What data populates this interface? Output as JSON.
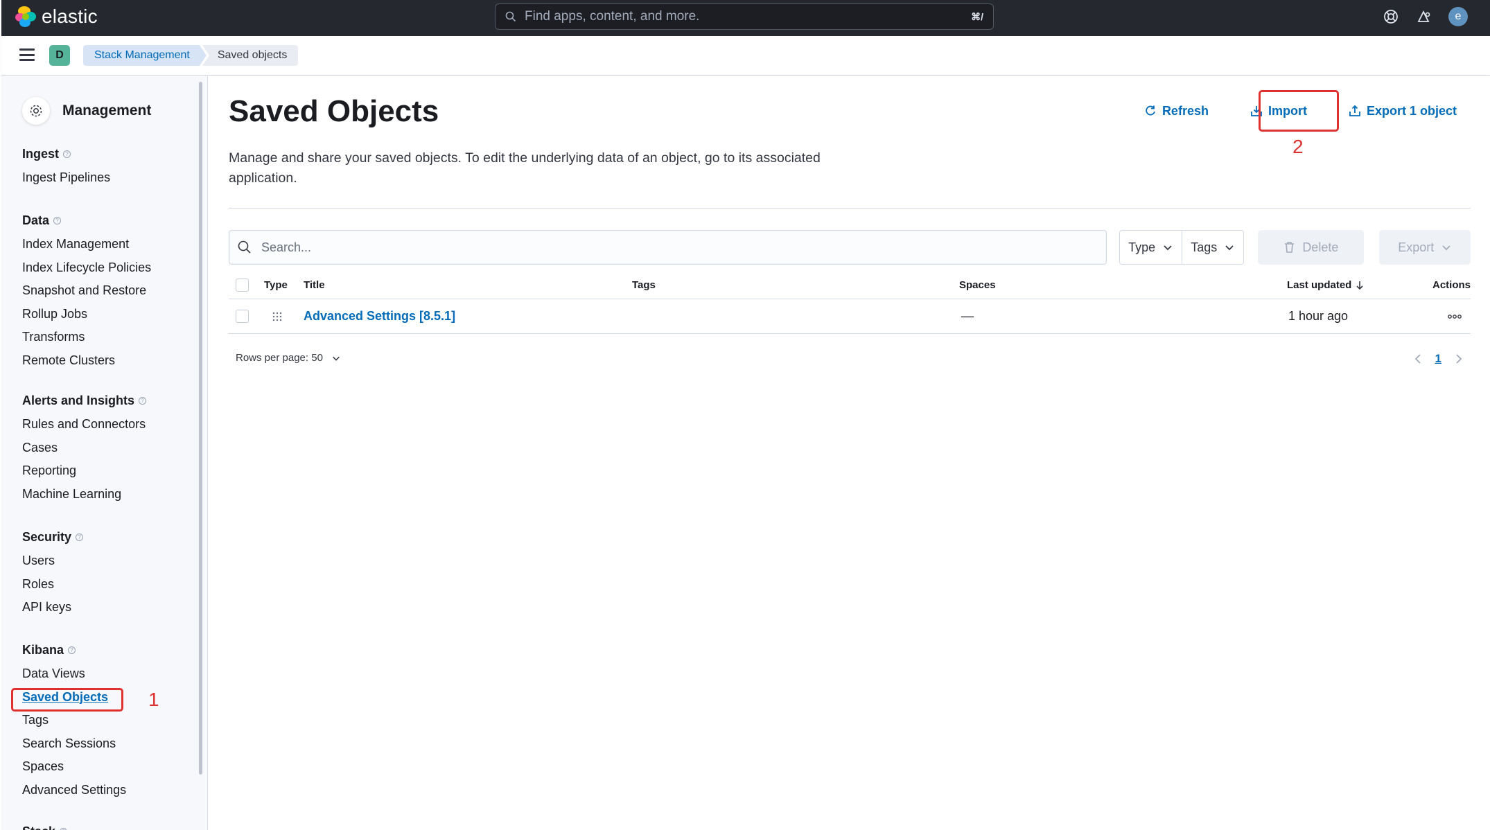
{
  "header": {
    "logo_text": "elastic",
    "search_placeholder": "Find apps, content, and more.",
    "search_shortcut": "⌘/",
    "user_initial": "e"
  },
  "breadcrumb": {
    "space_initial": "D",
    "items": [
      "Stack Management",
      "Saved objects"
    ]
  },
  "sidebar": {
    "title": "Management",
    "groups": [
      {
        "title": "Ingest",
        "items": [
          "Ingest Pipelines"
        ]
      },
      {
        "title": "Data",
        "items": [
          "Index Management",
          "Index Lifecycle Policies",
          "Snapshot and Restore",
          "Rollup Jobs",
          "Transforms",
          "Remote Clusters"
        ]
      },
      {
        "title": "Alerts and Insights",
        "items": [
          "Rules and Connectors",
          "Cases",
          "Reporting",
          "Machine Learning"
        ]
      },
      {
        "title": "Security",
        "items": [
          "Users",
          "Roles",
          "API keys"
        ]
      },
      {
        "title": "Kibana",
        "items": [
          "Data Views",
          "Saved Objects",
          "Tags",
          "Search Sessions",
          "Spaces",
          "Advanced Settings"
        ]
      },
      {
        "title": "Stack",
        "items": []
      }
    ],
    "active_item": "Saved Objects"
  },
  "annotations": {
    "step1": "1",
    "step2": "2"
  },
  "main": {
    "title": "Saved Objects",
    "description": "Manage and share your saved objects. To edit the underlying data of an object, go to its associated application.",
    "actions": {
      "refresh": "Refresh",
      "import": "Import",
      "export": "Export 1 object"
    },
    "toolbar": {
      "search_placeholder": "Search...",
      "type_filter": "Type",
      "tags_filter": "Tags",
      "delete": "Delete",
      "export": "Export"
    },
    "table": {
      "columns": {
        "type": "Type",
        "title": "Title",
        "tags": "Tags",
        "spaces": "Spaces",
        "last_updated": "Last updated",
        "actions": "Actions"
      },
      "rows": [
        {
          "title": "Advanced Settings [8.5.1]",
          "tags": "",
          "spaces": "—",
          "last_updated": "1 hour ago"
        }
      ]
    },
    "pagination": {
      "rows_per_page": "Rows per page: 50",
      "current_page": "1"
    }
  },
  "colors": {
    "accent": "#006bb8",
    "annotation": "#e03131",
    "header_bg": "#25282f"
  }
}
